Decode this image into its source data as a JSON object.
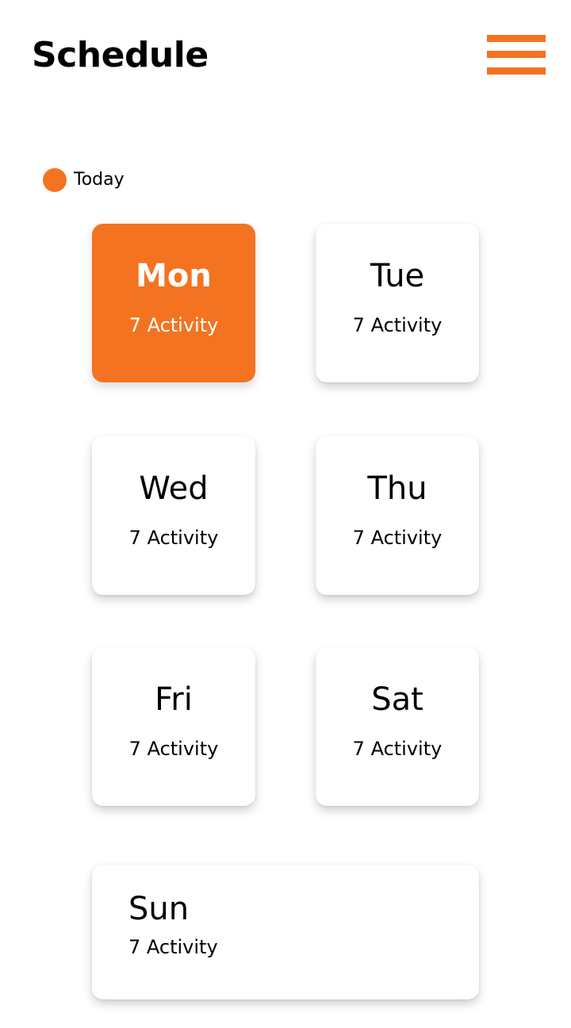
{
  "header": {
    "title": "Schedule",
    "menu_icon": "hamburger-menu-icon"
  },
  "legend": {
    "label": "Today",
    "color": "#f47321"
  },
  "colors": {
    "accent": "#f47321",
    "card_background": "#ffffff"
  },
  "days": [
    {
      "name": "Mon",
      "count": "7 Activity",
      "is_today": true
    },
    {
      "name": "Tue",
      "count": "7 Activity",
      "is_today": false
    },
    {
      "name": "Wed",
      "count": "7 Activity",
      "is_today": false
    },
    {
      "name": "Thu",
      "count": "7 Activity",
      "is_today": false
    },
    {
      "name": "Fri",
      "count": "7 Activity",
      "is_today": false
    },
    {
      "name": "Sat",
      "count": "7 Activity",
      "is_today": false
    },
    {
      "name": "Sun",
      "count": "7 Activity",
      "is_today": false
    }
  ]
}
